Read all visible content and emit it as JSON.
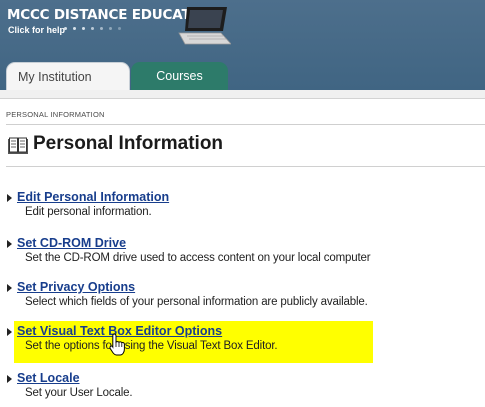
{
  "banner": {
    "title": "MCCC DISTANCE EDUCATION",
    "help_text": "Click for help"
  },
  "tabs": [
    {
      "label": "My Institution",
      "active": true
    },
    {
      "label": "Courses",
      "active": false
    }
  ],
  "breadcrumb": "PERSONAL INFORMATION",
  "page_title": "Personal Information",
  "items": [
    {
      "link": "Edit Personal Information",
      "description": "Edit personal information."
    },
    {
      "link": "Set CD-ROM Drive",
      "description": "Set the CD-ROM drive used to access content on your local computer"
    },
    {
      "link": "Set Privacy Options",
      "description": "Select which fields of your personal information are publicly available."
    },
    {
      "link": "Set Visual Text Box Editor Options",
      "description": "Set the options for using the Visual Text Box Editor.",
      "highlighted": true
    },
    {
      "link": "Set Locale",
      "description": "Set your User Locale."
    }
  ],
  "colors": {
    "banner": "#4d6f8c",
    "courses_tab": "#2d7b6a",
    "link": "#173d8c",
    "highlight": "#ffff00"
  }
}
